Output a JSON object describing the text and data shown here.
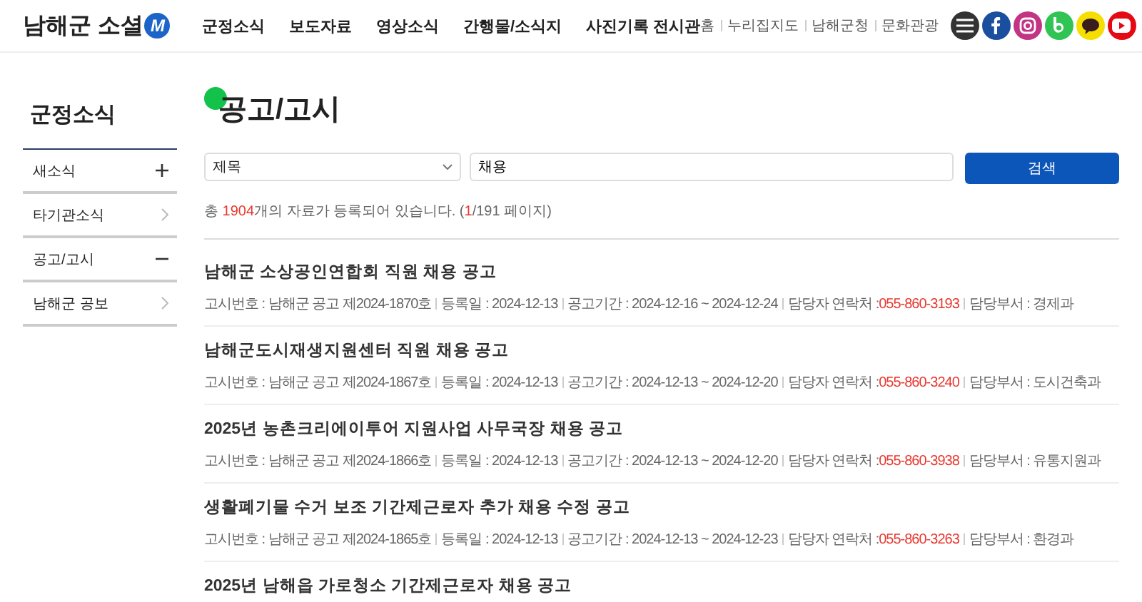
{
  "logo": {
    "text": "남해군 소셜",
    "badge": "M"
  },
  "nav": [
    "군정소식",
    "보도자료",
    "영상소식",
    "간행물/소식지",
    "사진기록 전시관"
  ],
  "util_links": [
    "홈",
    "누리집지도",
    "남해군청",
    "문화관광"
  ],
  "social": [
    {
      "kind": "menu"
    },
    {
      "kind": "facebook"
    },
    {
      "kind": "instagram"
    },
    {
      "kind": "blog"
    },
    {
      "kind": "talk"
    },
    {
      "kind": "youtube"
    }
  ],
  "sidebar": {
    "title": "군정소식",
    "items": [
      {
        "label": "새소식",
        "kind": "expandable",
        "expanded": false
      },
      {
        "label": "타기관소식",
        "kind": "link"
      },
      {
        "label": "공고/고시",
        "kind": "expandable",
        "expanded": true
      },
      {
        "label": "남해군 공보",
        "kind": "link"
      }
    ]
  },
  "page_title": "공고/고시",
  "search": {
    "category": "제목",
    "query": "채용",
    "button": "검색"
  },
  "count": {
    "prefix": "총 ",
    "total": "1904",
    "middle": "개의 자료가 등록되어 있습니다. (",
    "page": "1",
    "suffix": "/191 페이지)"
  },
  "notices": [
    {
      "title": "남해군 소상공인연합회 직원 채용 공고",
      "number": "고시번호 : 남해군 공고 제2024-1870호",
      "date": "등록일 : 2024-12-13",
      "period": "공고기간 : 2024-12-16 ~ 2024-12-24",
      "contact_label": "담당자 연락처 : ",
      "contact": "055-860-3193",
      "dept": "담당부서 : 경제과"
    },
    {
      "title": "남해군도시재생지원센터 직원 채용 공고",
      "number": "고시번호 : 남해군 공고 제2024-1867호",
      "date": "등록일 : 2024-12-13",
      "period": "공고기간 : 2024-12-13 ~ 2024-12-20",
      "contact_label": "담당자 연락처 : ",
      "contact": "055-860-3240",
      "dept": "담당부서 : 도시건축과"
    },
    {
      "title": "2025년 농촌크리에이투어 지원사업 사무국장 채용 공고",
      "number": "고시번호 : 남해군 공고 제2024-1866호",
      "date": "등록일 : 2024-12-13",
      "period": "공고기간 : 2024-12-13 ~ 2024-12-20",
      "contact_label": "담당자 연락처 : ",
      "contact": "055-860-3938",
      "dept": "담당부서 : 유통지원과"
    },
    {
      "title": "생활폐기물 수거 보조 기간제근로자 추가 채용 수정 공고",
      "number": "고시번호 : 남해군 공고 제2024-1865호",
      "date": "등록일 : 2024-12-13",
      "period": "공고기간 : 2024-12-13 ~ 2024-12-23",
      "contact_label": "담당자 연락처 : ",
      "contact": "055-860-3263",
      "dept": "담당부서 : 환경과"
    },
    {
      "title": "2025년 남해읍 가로청소 기간제근로자 채용 공고"
    }
  ]
}
